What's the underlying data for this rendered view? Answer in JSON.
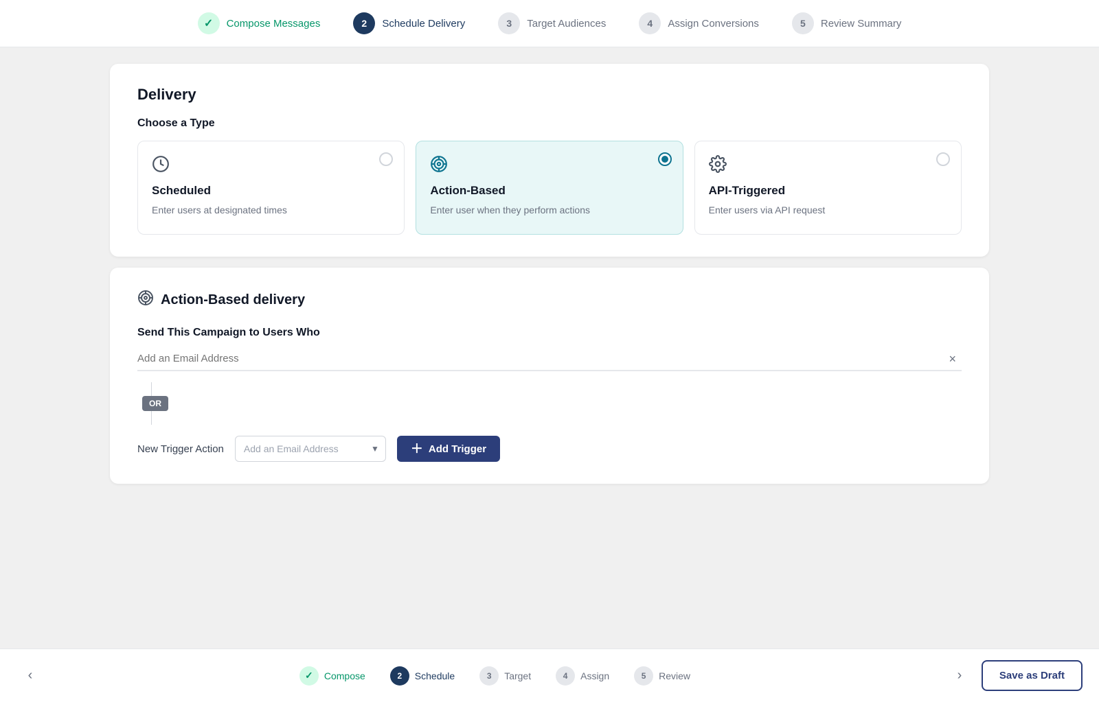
{
  "top_stepper": {
    "steps": [
      {
        "id": "compose",
        "number": "✓",
        "label": "Compose Messages",
        "state": "completed"
      },
      {
        "id": "schedule",
        "number": "2",
        "label": "Schedule Delivery",
        "state": "active"
      },
      {
        "id": "target",
        "number": "3",
        "label": "Target Audiences",
        "state": "inactive"
      },
      {
        "id": "assign",
        "number": "4",
        "label": "Assign Conversions",
        "state": "inactive"
      },
      {
        "id": "review",
        "number": "5",
        "label": "Review Summary",
        "state": "inactive"
      }
    ]
  },
  "delivery_card": {
    "title": "Delivery",
    "choose_type_label": "Choose a Type",
    "options": [
      {
        "id": "scheduled",
        "icon": "🕐",
        "title": "Scheduled",
        "description": "Enter users at designated times",
        "selected": false
      },
      {
        "id": "action-based",
        "icon": "🎯",
        "title": "Action-Based",
        "description": "Enter user when they perform actions",
        "selected": true
      },
      {
        "id": "api-triggered",
        "icon": "⚙️",
        "title": "API-Triggered",
        "description": "Enter users via API request",
        "selected": false
      }
    ]
  },
  "action_based_card": {
    "icon": "🎯",
    "title": "Action-Based delivery",
    "send_label": "Send This Campaign to Users Who",
    "email_placeholder": "Add an Email Address",
    "or_label": "OR",
    "trigger_row": {
      "label": "New Trigger Action",
      "select_placeholder": "Add an Email Address",
      "add_button_label": "Add Trigger"
    },
    "close_label": "×"
  },
  "bottom_bar": {
    "prev_label": "‹",
    "next_label": "›",
    "steps": [
      {
        "id": "compose",
        "number": "✓",
        "label": "Compose",
        "state": "completed"
      },
      {
        "id": "schedule",
        "number": "2",
        "label": "Schedule",
        "state": "active"
      },
      {
        "id": "target",
        "number": "3",
        "label": "Target",
        "state": "inactive"
      },
      {
        "id": "assign",
        "number": "4",
        "label": "Assign",
        "state": "inactive"
      },
      {
        "id": "review",
        "number": "5",
        "label": "Review",
        "state": "inactive"
      }
    ],
    "save_draft_label": "Save as Draft"
  }
}
